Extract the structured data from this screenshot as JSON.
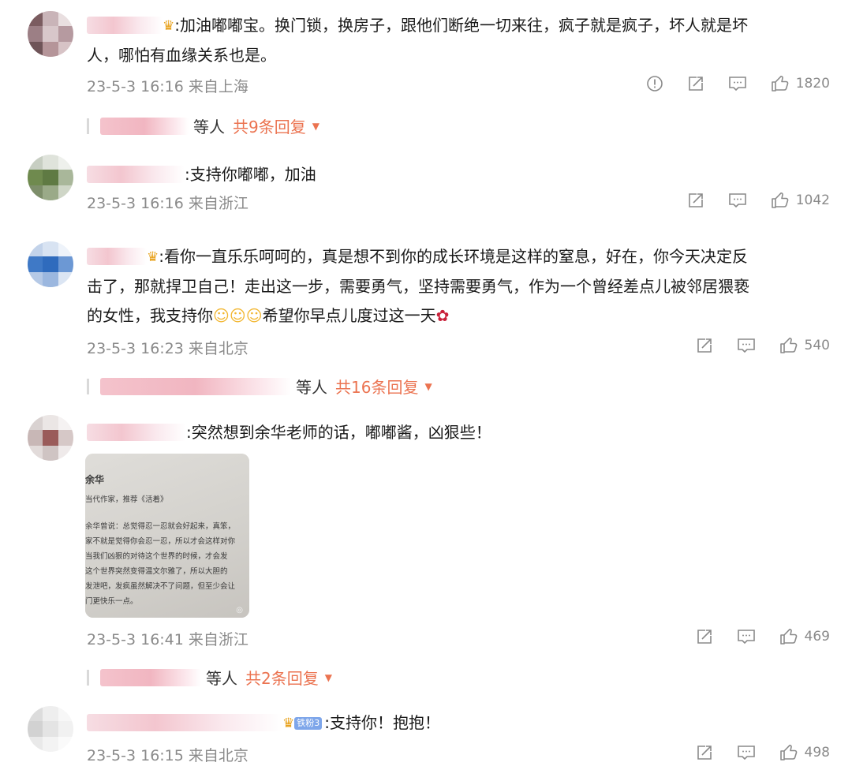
{
  "comments": [
    {
      "text_prefix": ":加油嘟嘟宝。换门锁，换房子，跟他们断绝一切来往，疯子就是疯子，坏人就是坏",
      "text_line2": "人，哪怕有血缘关系也是。",
      "meta": "23-5-3 16:16 来自上海",
      "likes": "1820",
      "replies": {
        "suffix": "等人",
        "count": "共9条回复"
      }
    },
    {
      "text_prefix": ":支持你嘟嘟，加油",
      "meta": "23-5-3 16:16 来自浙江",
      "likes": "1042"
    },
    {
      "text_line1": ":看你一直乐乐呵呵的，真是想不到你的成长环境是这样的窒息，好在，你今天决定反",
      "text_line2": "击了，那就捍卫自己！走出这一步，需要勇气，坚持需要勇气，作为一个曾经差点儿被邻居猥亵",
      "text_line3a": "的女性，我支持你",
      "text_line3b": "希望你早点儿度过这一天",
      "meta": "23-5-3 16:23 来自北京",
      "likes": "540",
      "replies": {
        "suffix": "等人",
        "count": "共16条回复"
      }
    },
    {
      "text_prefix": ":突然想到余华老师的话，嘟嘟酱，凶狠些！",
      "meta": "23-5-3 16:41 来自浙江",
      "likes": "469",
      "replies": {
        "suffix": "等人",
        "count": "共2条回复"
      },
      "image": {
        "lines": [
          "余华",
          "当代作家，推荐《活着》",
          "余华曾说：总觉得忍一忍就会好起来，真笨，",
          "家不就是觉得你会忍一忍，所以才会这样对你",
          "当我们凶狠的对待这个世界的时候，才会发",
          "这个世界突然变得温文尔雅了，所以大胆的",
          "发泄吧，发疯虽然解决不了问题，但至少会让",
          "门更快乐一点。"
        ]
      }
    },
    {
      "badge": "铁粉3",
      "text_prefix": ":支持你！抱抱！",
      "meta": "23-5-3 16:15 来自北京",
      "likes": "498"
    }
  ],
  "icons": {
    "report": "report-icon",
    "share": "share-icon",
    "comment": "comment-icon",
    "like": "like-icon",
    "vip": "crown-icon",
    "emoji_hug": "hug-emoji-icon",
    "emoji_rose": "rose-emoji-icon"
  },
  "colors": {
    "accent": "#eb7350",
    "meta": "#8a8a8a",
    "crown": "#e8a21c"
  }
}
